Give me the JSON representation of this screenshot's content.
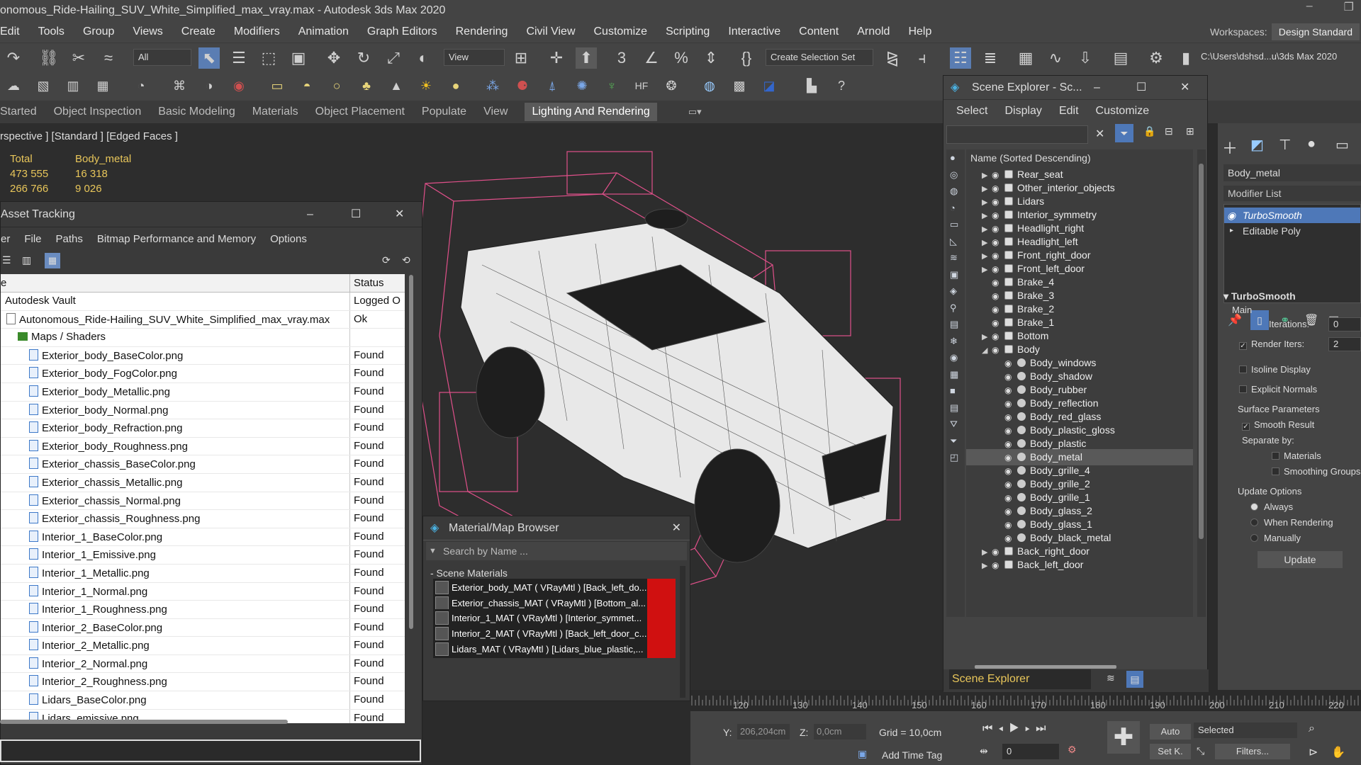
{
  "window": {
    "title": "onomous_Ride-Hailing_SUV_White_Simplified_max_vray.max - Autodesk 3ds Max 2020"
  },
  "menubar": {
    "items": [
      "Edit",
      "Tools",
      "Group",
      "Views",
      "Create",
      "Modifiers",
      "Animation",
      "Graph Editors",
      "Rendering",
      "Civil View",
      "Customize",
      "Scripting",
      "Interactive",
      "Content",
      "Arnold",
      "Help"
    ]
  },
  "workspaces": {
    "label": "Workspaces:",
    "value": "Design Standard"
  },
  "toolbar": {
    "filter": "All",
    "view": "View",
    "selection_set": "Create Selection Set",
    "path": "C:\\Users\\dshsd...u\\3ds Max 2020"
  },
  "ribbon": {
    "tabs": [
      "Started",
      "Object Inspection",
      "Basic Modeling",
      "Materials",
      "Object Placement",
      "Populate",
      "View",
      "Lighting And Rendering"
    ],
    "active": "Lighting And Rendering"
  },
  "viewport": {
    "label": "rspective ] [Standard ] [Edged Faces ]",
    "stats": {
      "h1": "Total",
      "h2": "Body_metal",
      "r1a": "473 555",
      "r1b": "16 318",
      "r2a": "266 766",
      "r2b": "9 026"
    }
  },
  "asset_tracking": {
    "title": "Asset Tracking",
    "menu": [
      "er",
      "File",
      "Paths",
      "Bitmap Performance and Memory",
      "Options"
    ],
    "columns": {
      "name": "e",
      "status": "Status"
    },
    "rows": [
      {
        "name": "Autodesk Vault",
        "status": "Logged O"
      },
      {
        "name": "Autonomous_Ride-Hailing_SUV_White_Simplified_max_vray.max",
        "status": "Ok"
      },
      {
        "name": "Maps / Shaders",
        "status": ""
      },
      {
        "name": "Exterior_body_BaseColor.png",
        "status": "Found"
      },
      {
        "name": "Exterior_body_FogColor.png",
        "status": "Found"
      },
      {
        "name": "Exterior_body_Metallic.png",
        "status": "Found"
      },
      {
        "name": "Exterior_body_Normal.png",
        "status": "Found"
      },
      {
        "name": "Exterior_body_Refraction.png",
        "status": "Found"
      },
      {
        "name": "Exterior_body_Roughness.png",
        "status": "Found"
      },
      {
        "name": "Exterior_chassis_BaseColor.png",
        "status": "Found"
      },
      {
        "name": "Exterior_chassis_Metallic.png",
        "status": "Found"
      },
      {
        "name": "Exterior_chassis_Normal.png",
        "status": "Found"
      },
      {
        "name": "Exterior_chassis_Roughness.png",
        "status": "Found"
      },
      {
        "name": "Interior_1_BaseColor.png",
        "status": "Found"
      },
      {
        "name": "Interior_1_Emissive.png",
        "status": "Found"
      },
      {
        "name": "Interior_1_Metallic.png",
        "status": "Found"
      },
      {
        "name": "Interior_1_Normal.png",
        "status": "Found"
      },
      {
        "name": "Interior_1_Roughness.png",
        "status": "Found"
      },
      {
        "name": "Interior_2_BaseColor.png",
        "status": "Found"
      },
      {
        "name": "Interior_2_Metallic.png",
        "status": "Found"
      },
      {
        "name": "Interior_2_Normal.png",
        "status": "Found"
      },
      {
        "name": "Interior_2_Roughness.png",
        "status": "Found"
      },
      {
        "name": "Lidars_BaseColor.png",
        "status": "Found"
      },
      {
        "name": "Lidars_emissive.png",
        "status": "Found"
      }
    ]
  },
  "material_browser": {
    "title": "Material/Map Browser",
    "search_placeholder": "Search by Name ...",
    "section": "- Scene Materials",
    "items": [
      "Exterior_body_MAT  ( VRayMtl )  [Back_left_do...",
      "Exterior_chassis_MAT  ( VRayMtl )  [Bottom_al...",
      "Interior_1_MAT  ( VRayMtl )  [Interior_symmet...",
      "Interior_2_MAT  ( VRayMtl )  [Back_left_door_c...",
      "Lidars_MAT  ( VRayMtl )  [Lidars_blue_plastic,..."
    ]
  },
  "scene_explorer": {
    "title": "Scene Explorer - Sc...",
    "menu": [
      "Select",
      "Display",
      "Edit",
      "Customize"
    ],
    "header": "Name (Sorted Descending)",
    "rows": [
      {
        "name": "Rear_seat",
        "expandable": true,
        "child": false
      },
      {
        "name": "Other_interior_objects",
        "expandable": true,
        "child": false
      },
      {
        "name": "Lidars",
        "expandable": true,
        "child": false
      },
      {
        "name": "Interior_symmetry",
        "expandable": true,
        "child": false
      },
      {
        "name": "Headlight_right",
        "expandable": true,
        "child": false
      },
      {
        "name": "Headlight_left",
        "expandable": true,
        "child": false
      },
      {
        "name": "Front_right_door",
        "expandable": true,
        "child": false
      },
      {
        "name": "Front_left_door",
        "expandable": true,
        "child": false
      },
      {
        "name": "Brake_4",
        "expandable": false,
        "child": false
      },
      {
        "name": "Brake_3",
        "expandable": false,
        "child": false
      },
      {
        "name": "Brake_2",
        "expandable": false,
        "child": false
      },
      {
        "name": "Brake_1",
        "expandable": false,
        "child": false
      },
      {
        "name": "Bottom",
        "expandable": true,
        "child": false
      },
      {
        "name": "Body",
        "expandable": true,
        "expanded": true,
        "child": false
      },
      {
        "name": "Body_windows",
        "expandable": false,
        "child": true
      },
      {
        "name": "Body_shadow",
        "expandable": false,
        "child": true
      },
      {
        "name": "Body_rubber",
        "expandable": false,
        "child": true
      },
      {
        "name": "Body_reflection",
        "expandable": false,
        "child": true
      },
      {
        "name": "Body_red_glass",
        "expandable": false,
        "child": true
      },
      {
        "name": "Body_plastic_gloss",
        "expandable": false,
        "child": true
      },
      {
        "name": "Body_plastic",
        "expandable": false,
        "child": true
      },
      {
        "name": "Body_metal",
        "expandable": false,
        "child": true,
        "selected": true
      },
      {
        "name": "Body_grille_4",
        "expandable": false,
        "child": true
      },
      {
        "name": "Body_grille_2",
        "expandable": false,
        "child": true
      },
      {
        "name": "Body_grille_1",
        "expandable": false,
        "child": true
      },
      {
        "name": "Body_glass_2",
        "expandable": false,
        "child": true
      },
      {
        "name": "Body_glass_1",
        "expandable": false,
        "child": true
      },
      {
        "name": "Body_black_metal",
        "expandable": false,
        "child": true
      },
      {
        "name": "Back_right_door",
        "expandable": true,
        "child": false
      },
      {
        "name": "Back_left_door",
        "expandable": true,
        "child": false
      }
    ],
    "bottom_label": "Scene Explorer"
  },
  "command_panel": {
    "object_name": "Body_metal",
    "modifier_list": "Modifier List",
    "stack": [
      "TurboSmooth",
      "Editable Poly"
    ],
    "rollout_title": "TurboSmooth",
    "main": "Main",
    "iterations_label": "Iterations:",
    "iterations": "0",
    "render_iters_label": "Render Iters:",
    "render_iters": "2",
    "isoline": "Isoline Display",
    "explicit": "Explicit Normals",
    "surface_params": "Surface Parameters",
    "smooth_result": "Smooth Result",
    "separate_by": "Separate by:",
    "materials": "Materials",
    "smoothing_groups": "Smoothing Groups",
    "update_options": "Update Options",
    "always": "Always",
    "when_rendering": "When Rendering",
    "manually": "Manually",
    "update": "Update"
  },
  "timeline": {
    "ticks": [
      "120",
      "130",
      "140",
      "150",
      "160",
      "170",
      "180",
      "190",
      "200",
      "210",
      "220"
    ]
  },
  "statusbar": {
    "y_label": "Y:",
    "y_value": "206,204cm",
    "z_label": "Z:",
    "z_value": "0,0cm",
    "grid": "Grid = 10,0cm",
    "add_time_tag": "Add Time Tag",
    "frame": "0",
    "auto": "Auto",
    "set_key": "Set K.",
    "selected": "Selected",
    "filters": "Filters..."
  },
  "colors": {
    "accent_blue": "#4e78b8",
    "stat_yellow": "#e8c65a",
    "wire_pink": "#e0508a",
    "error_red": "#d01010"
  }
}
